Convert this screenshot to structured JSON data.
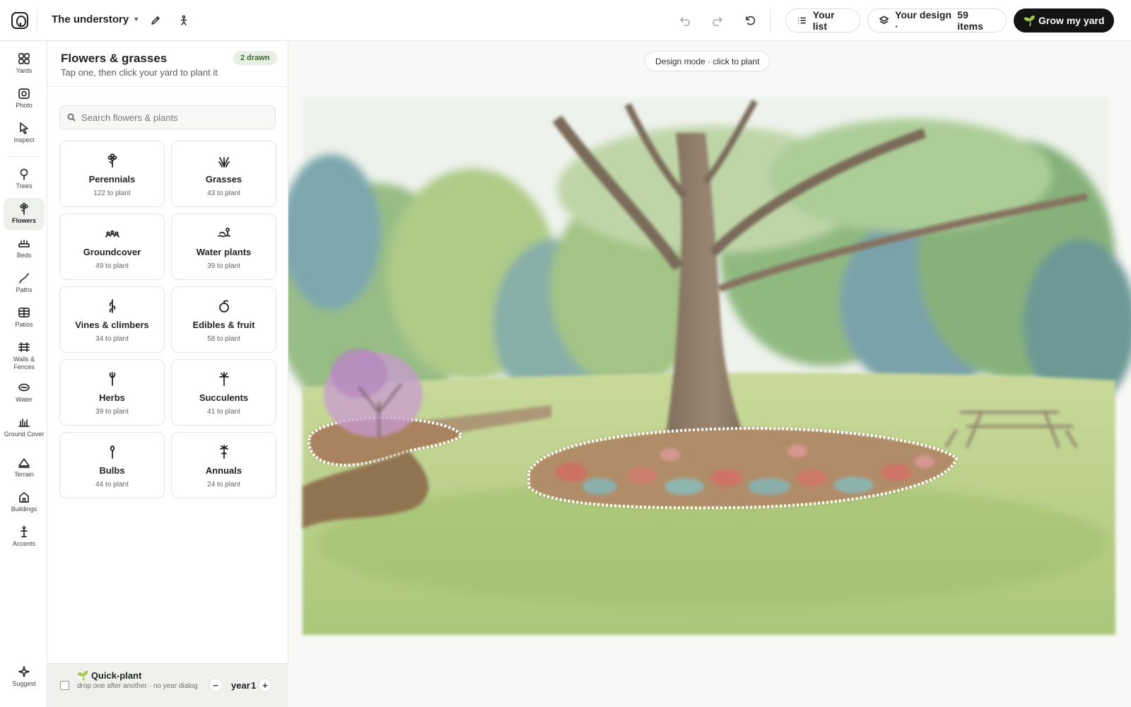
{
  "topbar": {
    "project_name": "The underst⁣ory",
    "your_list": "Your list",
    "your_design_label": "Your design ·",
    "your_design_count": "59 items",
    "cta": "Grow my yard",
    "cta_icon": "🌱"
  },
  "rail": {
    "items": [
      {
        "label": "Yards",
        "icon": "grid-icon"
      },
      {
        "label": "Photo",
        "icon": "camera-icon"
      },
      {
        "label": "Inspect",
        "icon": "pointer-icon"
      },
      {
        "label": "Trees",
        "icon": "tree-icon"
      },
      {
        "label": "Flowers",
        "icon": "flower-icon",
        "active": true
      },
      {
        "label": "Beds",
        "icon": "bed-icon"
      },
      {
        "label": "Paths",
        "icon": "path-icon"
      },
      {
        "label": "Patios",
        "icon": "patio-icon"
      },
      {
        "label": "Walls & Fences",
        "icon": "fence-icon"
      },
      {
        "label": "Water",
        "icon": "water-icon"
      },
      {
        "label": "Ground Cover",
        "icon": "groundcover-icon"
      },
      {
        "label": "Terrain",
        "icon": "terrain-icon"
      },
      {
        "label": "Buildings",
        "icon": "building-icon"
      },
      {
        "label": "Accents",
        "icon": "accent-icon"
      },
      {
        "label": "Suggest",
        "icon": "sparkle-icon"
      }
    ]
  },
  "panel": {
    "title": "Flowers & grasses",
    "subtitle": "Tap one, then click your yard to plant it",
    "badge": "2 drawn",
    "search_placeholder": "Search flowers & plants",
    "categories": [
      {
        "name": "Perennials",
        "count": "122 to plant",
        "icon": "perennial-icon"
      },
      {
        "name": "Grasses",
        "count": "43 to plant",
        "icon": "grass-icon"
      },
      {
        "name": "Groundcover",
        "count": "49 to plant",
        "icon": "groundcover-icon"
      },
      {
        "name": "Water plants",
        "count": "39 to plant",
        "icon": "water-plant-icon"
      },
      {
        "name": "Vines & climbers",
        "count": "34 to plant",
        "icon": "vine-icon"
      },
      {
        "name": "Edibles & fruit",
        "count": "58 to plant",
        "icon": "fruit-icon"
      },
      {
        "name": "Herbs",
        "count": "39 to plant",
        "icon": "herb-icon"
      },
      {
        "name": "Succulents",
        "count": "41 to plant",
        "icon": "succulent-icon"
      },
      {
        "name": "Bulbs",
        "count": "44 to plant",
        "icon": "bulb-icon"
      },
      {
        "name": "Annuals",
        "count": "24 to plant",
        "icon": "annual-icon"
      }
    ]
  },
  "quick_plant": {
    "icon": "🌱",
    "title": "Quick-plant",
    "subtitle": "drop one after another · no year dialog",
    "year_label": "year",
    "year_value": "1",
    "minus": "−",
    "plus": "+"
  },
  "canvas": {
    "mode_chip": "Design mode · click to plant"
  },
  "colors": {
    "accent_dark": "#141414",
    "badge_bg": "#e9efe5",
    "badge_text": "#3c6b2e"
  }
}
